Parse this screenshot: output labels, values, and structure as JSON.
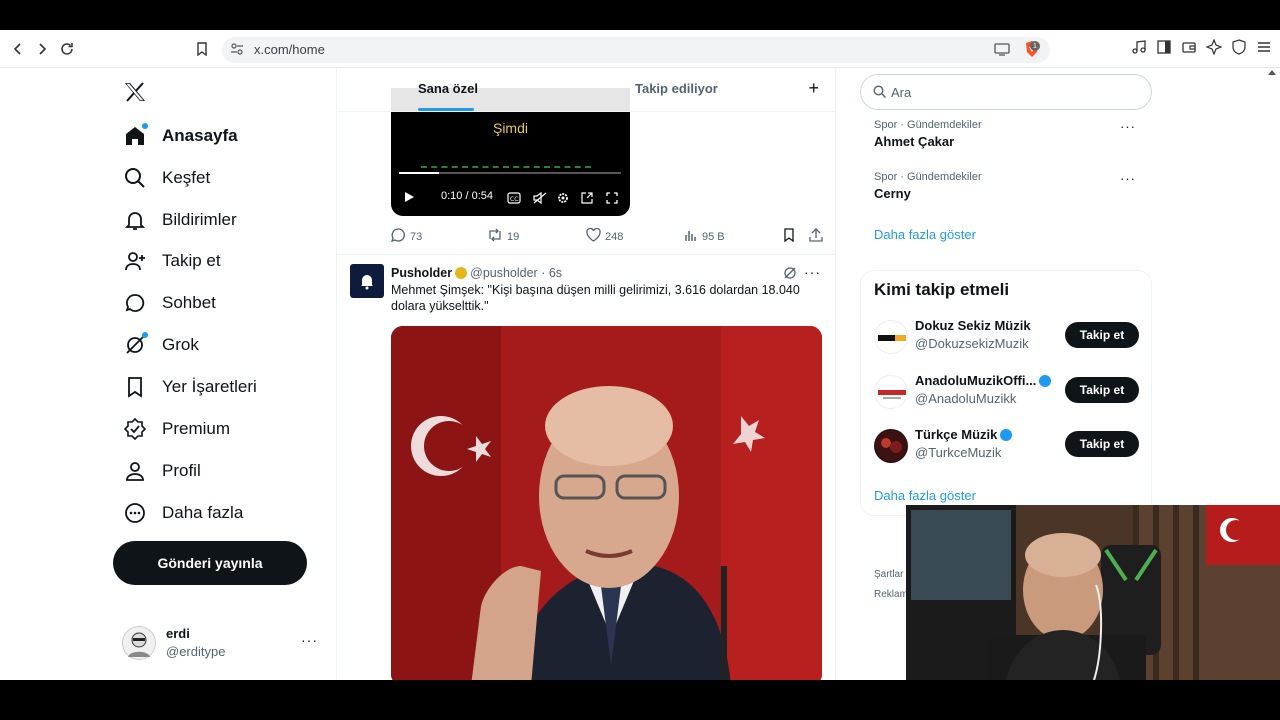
{
  "browser": {
    "url": "x.com/home",
    "shield_count": "1"
  },
  "sidebar": {
    "items": [
      {
        "label": "Anasayfa",
        "icon": "home-icon"
      },
      {
        "label": "Keşfet",
        "icon": "search-icon"
      },
      {
        "label": "Bildirimler",
        "icon": "bell-icon"
      },
      {
        "label": "Takip et",
        "icon": "person-add-icon"
      },
      {
        "label": "Sohbet",
        "icon": "chat-icon"
      },
      {
        "label": "Grok",
        "icon": "grok-icon"
      },
      {
        "label": "Yer İşaretleri",
        "icon": "bookmark-icon"
      },
      {
        "label": "Premium",
        "icon": "verified-icon"
      },
      {
        "label": "Profil",
        "icon": "person-icon"
      },
      {
        "label": "Daha fazla",
        "icon": "more-circle-icon"
      }
    ],
    "post_button": "Gönderi yayınla",
    "user": {
      "name": "erdi",
      "handle": "@erditype",
      "more": "···"
    }
  },
  "main": {
    "tabs": [
      {
        "label": "Sana özel"
      },
      {
        "label": "Takip ediliyor"
      }
    ],
    "add_tab": "+",
    "video": {
      "caption": "Şimdi",
      "time": "0:10 / 0:54",
      "progress": 0.18
    },
    "tweet1_actions": {
      "replies": "73",
      "retweets": "19",
      "likes": "248",
      "views": "95 B"
    },
    "tweet2": {
      "name": "Pusholder",
      "handle": "@pusholder · 6s",
      "text": "Mehmet Şimşek: \"Kişi başına düşen milli gelirimizi, 3.616 dolardan 18.040 dolara yükselttik.\"",
      "more": "···"
    }
  },
  "right": {
    "search_placeholder": "Ara",
    "trends": [
      {
        "category": "Spor · Gündemdekiler",
        "title": "Ahmet Çakar"
      },
      {
        "category": "Spor · Gündemdekiler",
        "title": "Cerny"
      }
    ],
    "trend_more": "···",
    "show_more": "Daha fazla göster",
    "who_to_follow_title": "Kimi takip etmeli",
    "follow_button": "Takip et",
    "suggestions": [
      {
        "name": "Dokuz Sekiz Müzik",
        "handle": "@DokuzsekizMuzik",
        "verified": false
      },
      {
        "name": "AnadoluMuzikOffi...",
        "handle": "@AnadoluMuzikk",
        "verified": true
      },
      {
        "name": "Türkçe Müzik",
        "handle": "@TurkceMuzik",
        "verified": true
      }
    ],
    "footer": [
      "Şartlar",
      "Reklam"
    ]
  },
  "colors": {
    "accent": "#1d9bf0",
    "text": "#0f1419",
    "muted": "#536471",
    "flag_red": "#c62828"
  }
}
